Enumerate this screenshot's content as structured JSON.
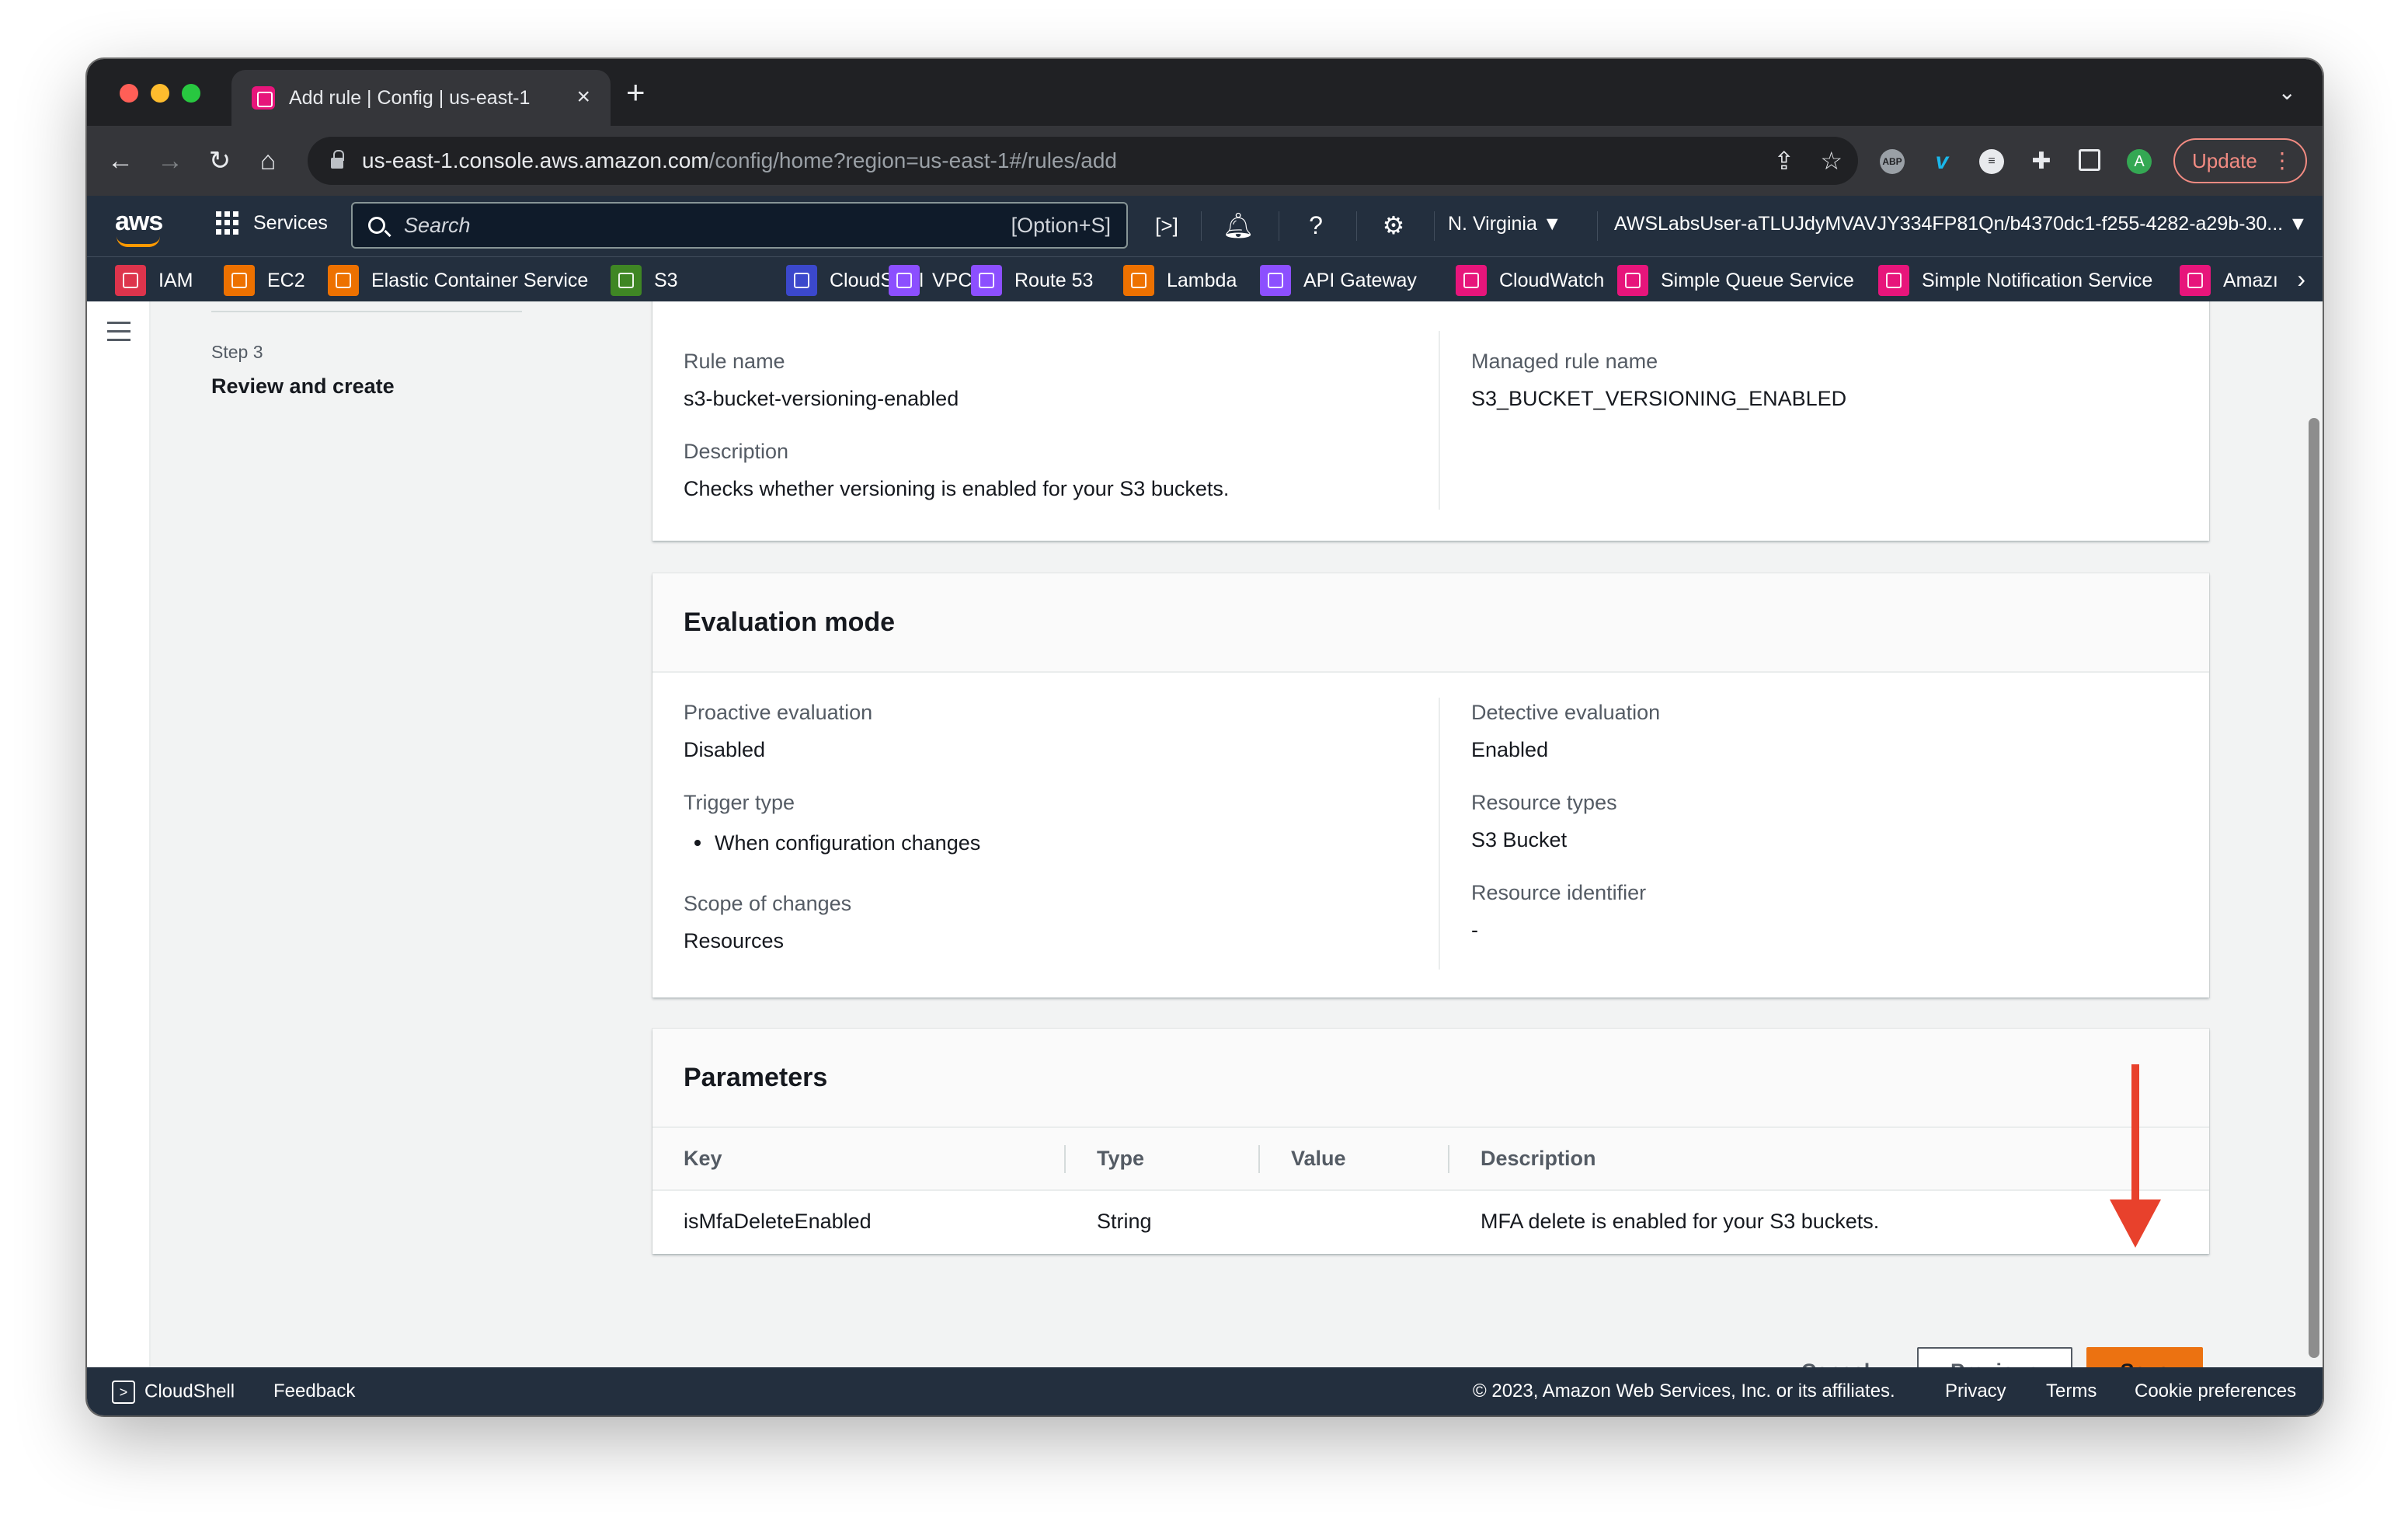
{
  "browser": {
    "tab_title": "Add rule | Config | us-east-1",
    "tab_close": "×",
    "new_tab": "+",
    "url_host": "us-east-1.console.aws.amazon.com",
    "url_path": "/config/home?region=us-east-1#/rules/add",
    "update_label": "Update",
    "profile_initial": "A"
  },
  "aws_nav": {
    "logo": "aws",
    "services_label": "Services",
    "search_placeholder": "Search",
    "search_shortcut": "[Option+S]",
    "region": "N. Virginia ▼",
    "account": "AWSLabsUser-aTLUJdyMVAVJY334FP81Qn/b4370dc1-f255-4282-a29b-30... ▼"
  },
  "favorites": [
    {
      "label": "IAM",
      "color": "#dd344c"
    },
    {
      "label": "EC2",
      "color": "#ed7100"
    },
    {
      "label": "Elastic Container Service",
      "color": "#ed7100"
    },
    {
      "label": "S3",
      "color": "#3f8624"
    },
    {
      "label": "CloudShell",
      "color": "#3b48cc"
    },
    {
      "label": "VPC",
      "color": "#8c4fff"
    },
    {
      "label": "Route 53",
      "color": "#8c4fff"
    },
    {
      "label": "Lambda",
      "color": "#ed7100"
    },
    {
      "label": "API Gateway",
      "color": "#8c4fff"
    },
    {
      "label": "CloudWatch",
      "color": "#e7157b"
    },
    {
      "label": "Simple Queue Service",
      "color": "#e7157b"
    },
    {
      "label": "Simple Notification Service",
      "color": "#e7157b"
    },
    {
      "label": "Amazı",
      "color": "#e7157b"
    }
  ],
  "wizard": {
    "step_label": "Step 3",
    "step_title": "Review and create"
  },
  "rule_details": {
    "rule_name_label": "Rule name",
    "rule_name_value": "s3-bucket-versioning-enabled",
    "description_label": "Description",
    "description_value": "Checks whether versioning is enabled for your S3 buckets.",
    "managed_rule_label": "Managed rule name",
    "managed_rule_value": "S3_BUCKET_VERSIONING_ENABLED"
  },
  "evaluation_mode": {
    "title": "Evaluation mode",
    "proactive_label": "Proactive evaluation",
    "proactive_value": "Disabled",
    "trigger_label": "Trigger type",
    "trigger_value": "When configuration changes",
    "scope_label": "Scope of changes",
    "scope_value": "Resources",
    "detective_label": "Detective evaluation",
    "detective_value": "Enabled",
    "resource_types_label": "Resource types",
    "resource_types_value": "S3 Bucket",
    "resource_id_label": "Resource identifier",
    "resource_id_value": "-"
  },
  "parameters": {
    "title": "Parameters",
    "columns": [
      "Key",
      "Type",
      "Value",
      "Description"
    ],
    "rows": [
      [
        "isMfaDeleteEnabled",
        "String",
        "",
        "MFA delete is enabled for your S3 buckets."
      ]
    ]
  },
  "actions": {
    "cancel": "Cancel",
    "previous": "Previous",
    "save": "Save"
  },
  "footer": {
    "cloudshell": "CloudShell",
    "feedback": "Feedback",
    "copyright": "© 2023, Amazon Web Services, Inc. or its affiliates.",
    "privacy": "Privacy",
    "terms": "Terms",
    "cookies": "Cookie preferences"
  },
  "colors": {
    "save_button": "#ec7211",
    "annotation_arrow": "#e8412c",
    "aws_nav_bg": "#232f3e"
  }
}
